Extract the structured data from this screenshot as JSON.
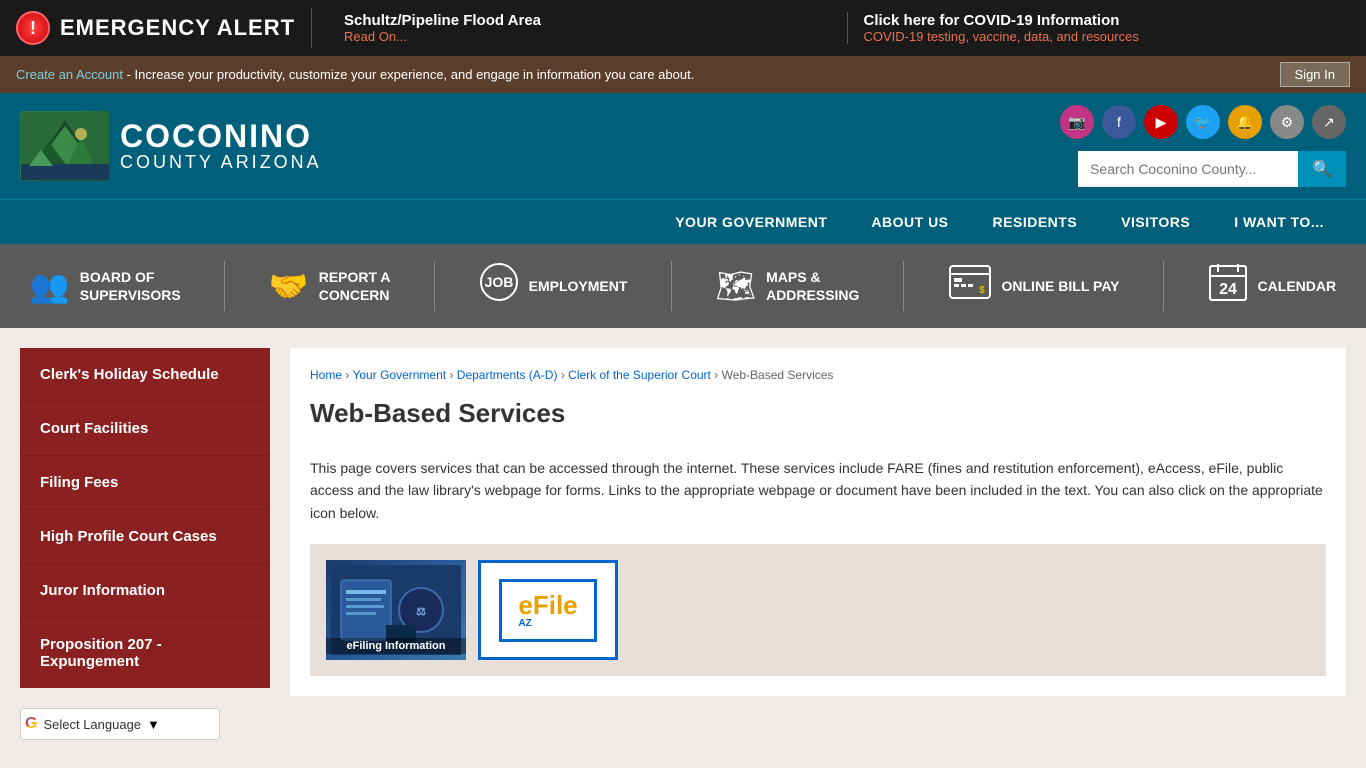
{
  "emergency": {
    "alert_icon": "!",
    "title": "EMERGENCY ALERT",
    "flood_title": "Schultz/Pipeline Flood Area",
    "flood_link": "Read On...",
    "covid_title": "Click here for COVID-19 Information",
    "covid_sub": "COVID-19 testing, vaccine, data, and resources"
  },
  "account_bar": {
    "create_account": "Create an Account",
    "tagline": " - Increase your productivity, customize your experience, and engage in information you care about.",
    "sign_in": "Sign In"
  },
  "logo": {
    "county_name": "COCONINO",
    "county_sub": "COUNTY ARIZONA"
  },
  "search": {
    "placeholder": "Search Coconino County..."
  },
  "nav": {
    "items": [
      {
        "label": "YOUR GOVERNMENT"
      },
      {
        "label": "ABOUT US"
      },
      {
        "label": "RESIDENTS"
      },
      {
        "label": "VISITORS"
      },
      {
        "label": "I WANT TO..."
      }
    ]
  },
  "quick_links": [
    {
      "icon": "👥",
      "line1": "BOARD OF",
      "line2": "SUPERVISORS"
    },
    {
      "icon": "🤝",
      "line1": "REPORT A",
      "line2": "CONCERN"
    },
    {
      "icon": "💼",
      "line1": "EMPLOYMENT",
      "line2": ""
    },
    {
      "icon": "🗺",
      "line1": "MAPS &",
      "line2": "ADDRESSING"
    },
    {
      "icon": "💲",
      "line1": "ONLINE BILL PAY",
      "line2": ""
    },
    {
      "icon": "📅",
      "line1": "CALENDAR",
      "line2": "24"
    }
  ],
  "sidebar": {
    "items": [
      {
        "label": "Clerk's Holiday Schedule"
      },
      {
        "label": "Court Facilities"
      },
      {
        "label": "Filing Fees"
      },
      {
        "label": "High Profile Court Cases"
      },
      {
        "label": "Juror Information"
      },
      {
        "label": "Proposition 207 - Expungement"
      }
    ]
  },
  "translate": {
    "label": "Select Language"
  },
  "breadcrumb": {
    "items": [
      "Home",
      "Your Government",
      "Departments (A-D)",
      "Clerk of the Superior Court",
      "Web-Based Services"
    ]
  },
  "main": {
    "page_title": "Web-Based Services",
    "description": "This page covers services that can be accessed through the internet.   These services include FARE (fines and restitution enforcement), eAccess, eFile, public access and the law library's webpage for forms.   Links to the appropriate webpage or document have been included in the text.   You can also click on the appropriate icon below.",
    "efiling_label": "eFiling Information",
    "efile_az": "eFile",
    "efile_az_sub": "AZ"
  }
}
